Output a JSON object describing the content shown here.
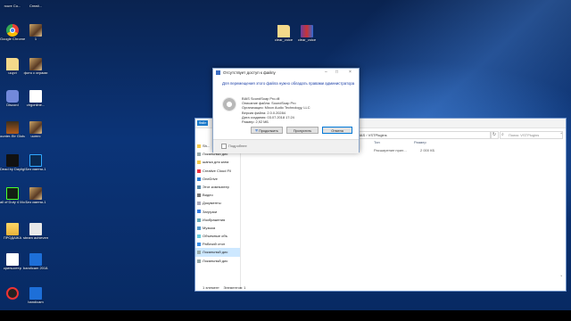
{
  "desktop": {
    "icons": [
      {
        "label": "rcure Co...",
        "pic": "folder",
        "name": "desktop-icon-rcure"
      },
      {
        "label": "Creati...",
        "pic": "folder",
        "name": "desktop-icon-creati"
      },
      {
        "label": "Google Chrome",
        "pic": "chrome",
        "name": "desktop-icon-chrome"
      },
      {
        "label": "1",
        "pic": "photo",
        "name": "desktop-icon-1"
      },
      {
        "label": "uuyvi",
        "pic": "file",
        "name": "desktop-icon-uuyvi"
      },
      {
        "label": "фото с играми",
        "pic": "photo",
        "name": "desktop-icon-foto"
      },
      {
        "label": "Discord",
        "pic": "discord",
        "name": "desktop-icon-discord"
      },
      {
        "label": "virgonline...",
        "pic": "gdoc",
        "name": "desktop-icon-virgonline"
      },
      {
        "label": "ounter-Str Global Offe...",
        "pic": "game",
        "name": "desktop-icon-counter-strike"
      },
      {
        "label": "uumrc",
        "pic": "photo",
        "name": "desktop-icon-uumrc"
      },
      {
        "label": "Dead by Daylight",
        "pic": "dbd",
        "name": "desktop-icon-dead-by-daylight"
      },
      {
        "label": "Без имени-1",
        "pic": "ps",
        "name": "desktop-icon-bez-imeni"
      },
      {
        "label": "all of Duty 4 Modern Wa...",
        "pic": "cod",
        "name": "desktop-icon-call-of-duty"
      },
      {
        "label": "Без имени-1",
        "pic": "photo",
        "name": "desktop-icon-bez-imeni-2"
      },
      {
        "label": "ПРОДАЖА",
        "pic": "folder",
        "name": "desktop-icon-prodazha"
      },
      {
        "label": "steam achieveme...",
        "pic": "steam",
        "name": "desktop-icon-steam"
      },
      {
        "label": "криншотер",
        "pic": "prod",
        "name": "desktop-icon-screenshoter"
      },
      {
        "label": "bandicam 2018-07-03...",
        "pic": "bandi",
        "name": "desktop-icon-bandicam"
      },
      {
        "label": "",
        "pic": "rec",
        "name": "desktop-icon-record"
      },
      {
        "label": "bandicam",
        "pic": "bandi",
        "name": "desktop-icon-bandicam-2"
      },
      {
        "label": "clear_voice",
        "pic": "file",
        "name": "desktop-icon-clear-voice"
      },
      {
        "label": "clear_voice",
        "pic": "rar",
        "name": "desktop-icon-clear-voice-rar"
      }
    ]
  },
  "explorer": {
    "tab_label": "Файл",
    "address": "BIAS  ›  VSTPlugins",
    "search_placeholder": "Поиск: VSTPlugins",
    "columns": [
      "Тип",
      "Размер"
    ],
    "row": {
      "type": "Расширение прил...",
      "size": "2 000 КБ"
    },
    "nav": [
      {
        "label": "Sh...",
        "selected": false
      },
      {
        "label": "Локальный дис",
        "selected": false
      },
      {
        "label": "шапка для кана",
        "selected": false
      },
      {
        "label": "Creative Cloud Fil",
        "selected": false
      },
      {
        "label": "OneDrive",
        "selected": false
      },
      {
        "label": "Этот компьютер",
        "selected": false
      },
      {
        "label": "Видео",
        "selected": false
      },
      {
        "label": "Документы",
        "selected": false
      },
      {
        "label": "Загрузки",
        "selected": false
      },
      {
        "label": "Изображения",
        "selected": false
      },
      {
        "label": "Музыка",
        "selected": false
      },
      {
        "label": "Объемные объ",
        "selected": false
      },
      {
        "label": "Рабочий стол",
        "selected": false
      },
      {
        "label": "Локальный дис",
        "selected": true
      },
      {
        "label": "Локальный дис",
        "selected": false
      }
    ],
    "status_items": "1 элемент",
    "status_selected": "Элементов: 1"
  },
  "dialog": {
    "title": "Отсутствует доступ к файлу",
    "heading": "Для перемещения этого файла нужно обладать правами администратора",
    "details": [
      "BIAS SoundSoap Pro.dll",
      "Описание файла: SoundSoap Pro",
      "Организация: Mixon Audio Technology, LLC",
      "Версия файла: 2.0.0.20284",
      "Дата создания: 03.07.2018 17:24",
      "Размер: 2,92 МБ"
    ],
    "continue_label": "Продолжить",
    "skip_label": "Пропустить",
    "cancel_label": "Отмена",
    "more_label": "Подробнее"
  },
  "colors": {
    "accent": "#0078d7",
    "dialog_heading": "#1a3ea6",
    "desktop_bg": "#0b3478"
  }
}
